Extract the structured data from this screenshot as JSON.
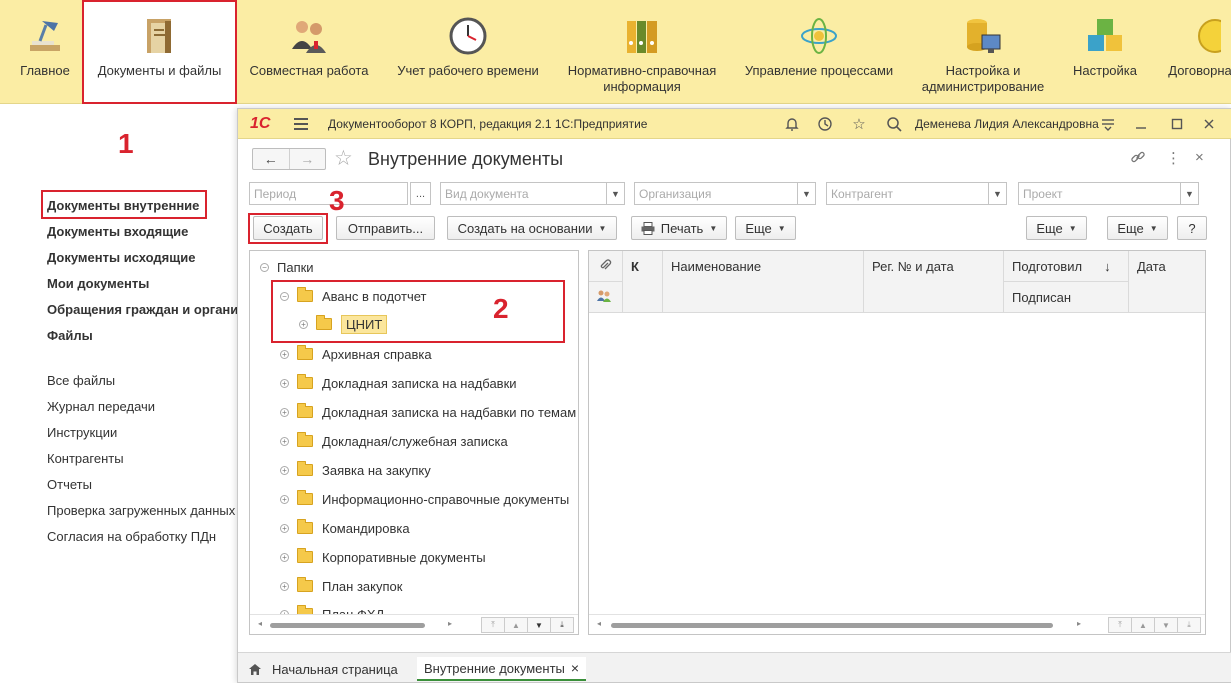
{
  "sections": [
    {
      "label": "Главное",
      "icon": "desk-lamp-icon"
    },
    {
      "label": "Документы и файлы",
      "icon": "document-folder-icon"
    },
    {
      "label": "Совместная работа",
      "icon": "people-icon"
    },
    {
      "label": "Учет рабочего времени",
      "icon": "clock-icon"
    },
    {
      "label": "Нормативно-справочная информация",
      "icon": "binders-icon"
    },
    {
      "label": "Управление процессами",
      "icon": "process-icon"
    },
    {
      "label": "Настройка и администрирование",
      "icon": "server-icon"
    },
    {
      "label": "Настройка",
      "icon": "cubes-icon"
    },
    {
      "label": "Договорна",
      "icon": "contract-icon"
    }
  ],
  "annotations": {
    "one": "1",
    "two": "2",
    "three": "3"
  },
  "nav": {
    "bold": [
      "Документы внутренние",
      "Документы входящие",
      "Документы исходящие",
      "Мои документы",
      "Обращения граждан и организаций",
      "Файлы"
    ],
    "items": [
      "Все файлы",
      "Журнал передачи",
      "Инструкции",
      "Контрагенты",
      "Отчеты",
      "Проверка загруженных данных",
      "Согласия на обработку ПДн"
    ]
  },
  "window": {
    "logo": "1С",
    "app_title": "Документооборот 8 КОРП, редакция 2.1 1С:Предприятие",
    "user": "Деменева Лидия Александровна",
    "form_title": "Внутренние документы",
    "filters": {
      "period": "Период",
      "period_btn": "...",
      "doc_type": "Вид документа",
      "organization": "Организация",
      "counterparty": "Контрагент",
      "project": "Проект"
    },
    "buttons": {
      "create": "Создать",
      "send": "Отправить...",
      "create_based": "Создать на основании",
      "print": "Печать",
      "more1": "Еще",
      "more2": "Еще",
      "more3": "Еще",
      "help": "?"
    },
    "tree": {
      "root": "Папки",
      "items": [
        "Аванс в подотчет",
        "ЦНИТ",
        "Архивная справка",
        "Докладная записка на надбавки",
        "Докладная записка на надбавки по темам",
        "Докладная/служебная записка",
        "Заявка на закупку",
        "Информационно-справочные документы",
        "Командировка",
        "Корпоративные документы",
        "План закупок",
        "План ФХД"
      ]
    },
    "table": {
      "col_k": "К",
      "col_name": "Наименование",
      "col_reg": "Рег. № и дата",
      "col_prepared": "Подготовил",
      "col_signed": "Подписан",
      "col_date": "Дата",
      "sort_arrow": "↓"
    },
    "tabs": {
      "home": "Начальная страница",
      "current": "Внутренние документы",
      "close": "×"
    }
  }
}
